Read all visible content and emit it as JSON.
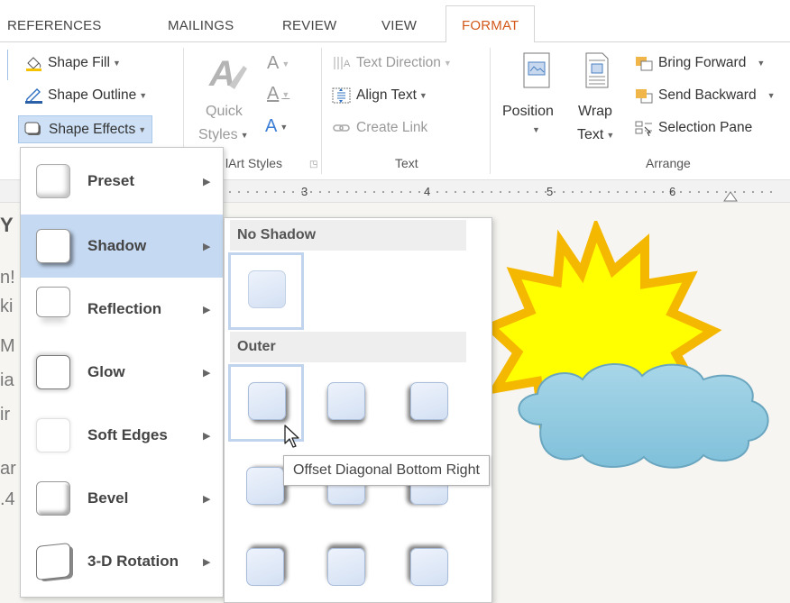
{
  "tabs": [
    {
      "label": "REFERENCES",
      "active": false
    },
    {
      "label": "MAILINGS",
      "active": false
    },
    {
      "label": "REVIEW",
      "active": false
    },
    {
      "label": "VIEW",
      "active": false
    },
    {
      "label": "FORMAT",
      "active": true
    }
  ],
  "colors": {
    "accent_tab": "#d2581a",
    "selected_item": "#c5d9f2",
    "sun_fill": "#ffff00",
    "sun_border": "#f5b800",
    "cloud_fill": "#8ecae0"
  },
  "ribbon": {
    "shape_styles": {
      "fill": "Shape Fill",
      "outline": "Shape Outline",
      "effects": "Shape Effects"
    },
    "wordart": {
      "quick_styles_line1": "Quick",
      "quick_styles_line2": "Styles",
      "text_fill_glyph": "A",
      "text_outline_glyph": "A",
      "text_effects_glyph": "A",
      "group_label": "lArt Styles"
    },
    "text_group": {
      "direction": "Text Direction",
      "align": "Align Text",
      "create_link": "Create Link",
      "group_label": "Text"
    },
    "arrange": {
      "position": "Position",
      "wrap_line1": "Wrap",
      "wrap_line2": "Text",
      "bring_forward": "Bring Forward",
      "send_backward": "Send Backward",
      "selection_pane": "Selection Pane",
      "group_label": "Arrange"
    }
  },
  "ruler": {
    "numbers": [
      "3",
      "4",
      "5",
      "6"
    ]
  },
  "doc_fragments": [
    "Y",
    "n!",
    "ki",
    "M",
    "ia",
    "ir",
    "ar",
    ".4"
  ],
  "effects_menu": {
    "items": [
      {
        "label": "Preset",
        "selected": false,
        "icon": "preset-icon"
      },
      {
        "label": "Shadow",
        "selected": true,
        "icon": "shadow-icon"
      },
      {
        "label": "Reflection",
        "selected": false,
        "icon": "reflection-icon"
      },
      {
        "label": "Glow",
        "selected": false,
        "icon": "glow-icon"
      },
      {
        "label": "Soft Edges",
        "selected": false,
        "icon": "soft-edges-icon"
      },
      {
        "label": "Bevel",
        "selected": false,
        "icon": "bevel-icon"
      },
      {
        "label": "3-D Rotation",
        "selected": false,
        "icon": "3d-rotation-icon"
      }
    ]
  },
  "shadow_gallery": {
    "sections": [
      {
        "title": "No Shadow"
      },
      {
        "title": "Outer"
      }
    ]
  },
  "tooltip": {
    "text": "Offset Diagonal Bottom Right"
  }
}
